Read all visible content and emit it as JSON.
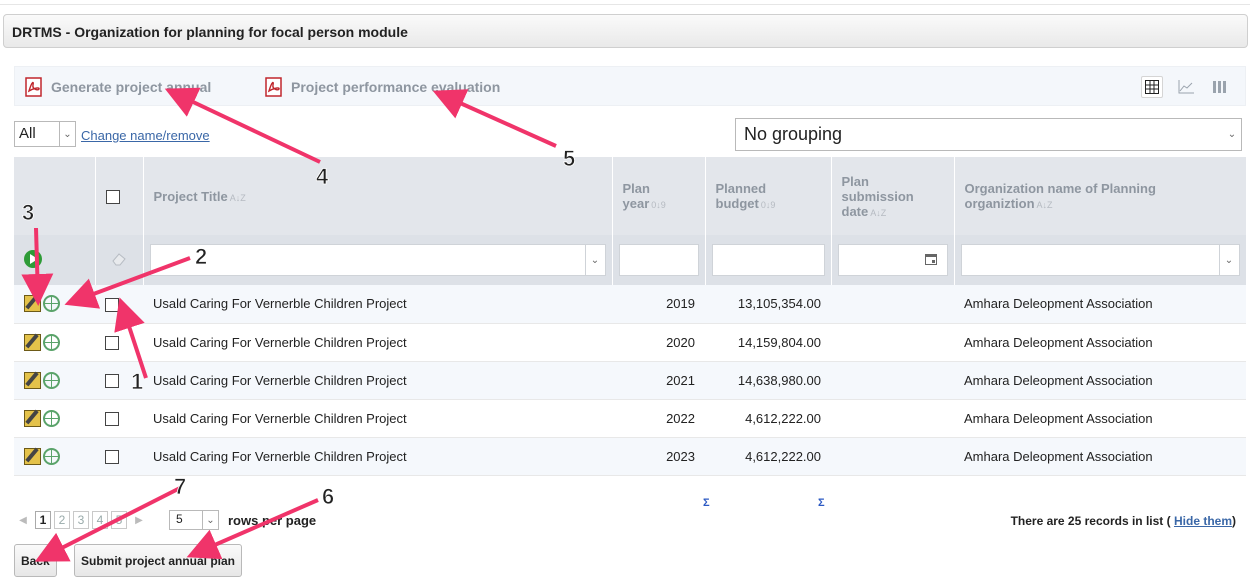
{
  "window": {
    "title": "DRTMS - Organization for planning for focal person module"
  },
  "toolbar": {
    "generate_label": "Generate project annual",
    "evaluation_label": "Project performance evaluation",
    "views": [
      "grid-view-icon",
      "chart-view-icon",
      "card-view-icon"
    ]
  },
  "filters": {
    "scope_value": "All",
    "change_link": "Change name/remove",
    "grouping_value": "No grouping"
  },
  "table": {
    "columns": [
      {
        "label": "Project Title",
        "sort": "A↓Z"
      },
      {
        "label": "Plan year",
        "sort": "0↓9"
      },
      {
        "label": "Planned budget",
        "sort": "0↓9"
      },
      {
        "label": "Plan submission date",
        "sort": "A↓Z"
      },
      {
        "label": "Organization name of Planning organiztion",
        "sort": "A↓Z"
      }
    ],
    "rows": [
      {
        "title": "Usald Caring For Vernerble Children Project",
        "year": "2019",
        "budget": "13,105,354.00",
        "date": "",
        "org": "Amhara Deleopment Association"
      },
      {
        "title": "Usald Caring For Vernerble Children Project",
        "year": "2020",
        "budget": "14,159,804.00",
        "date": "",
        "org": "Amhara Deleopment Association"
      },
      {
        "title": "Usald Caring For Vernerble Children Project",
        "year": "2021",
        "budget": "14,638,980.00",
        "date": "",
        "org": "Amhara Deleopment Association"
      },
      {
        "title": "Usald Caring For Vernerble Children Project",
        "year": "2022",
        "budget": "4,612,222.00",
        "date": "",
        "org": "Amhara Deleopment Association"
      },
      {
        "title": "Usald Caring For Vernerble Children Project",
        "year": "2023",
        "budget": "4,612,222.00",
        "date": "",
        "org": "Amhara Deleopment Association"
      }
    ],
    "sum_symbol": "Σ"
  },
  "pager": {
    "pages": [
      "1",
      "2",
      "3",
      "4",
      "5"
    ],
    "current": "1",
    "rows_per_page_value": "5",
    "rows_per_page_label": "rows per page",
    "records_text": "There are 25 records in list (",
    "hide_link": "Hide them",
    "records_close": ")"
  },
  "buttons": {
    "back": "Back",
    "submit": "Submit project annual plan"
  },
  "annotations": [
    "1",
    "2",
    "3",
    "4",
    "5",
    "6",
    "7"
  ],
  "colors": {
    "annotation": "#f0346a",
    "header_bg": "#e3e6eb",
    "link": "#3a67a7",
    "sum": "#2b59c3"
  }
}
